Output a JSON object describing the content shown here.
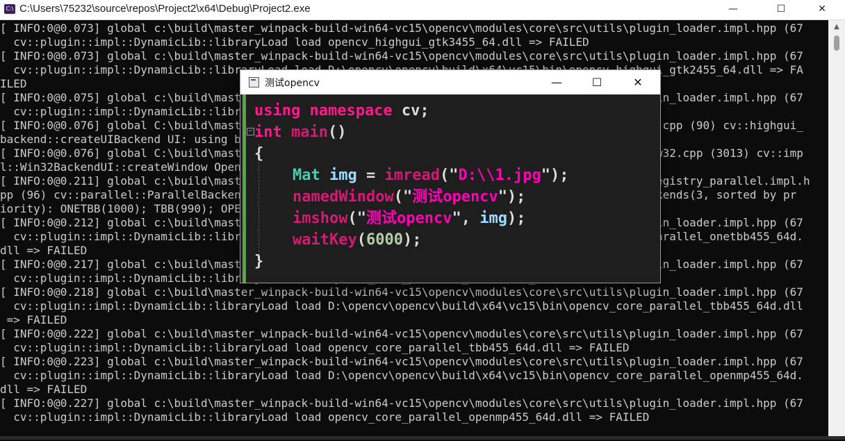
{
  "console_window": {
    "title": "C:\\Users\\75232\\source\\repos\\Project2\\x64\\Debug\\Project2.exe",
    "icon": "console-app-icon",
    "controls": {
      "minimize": "—",
      "maximize": "☐",
      "close": "✕"
    },
    "lines": [
      "[ INFO:0@0.073] global c:\\build\\master_winpack-build-win64-vc15\\opencv\\modules\\core\\src\\utils\\plugin_loader.impl.hpp (67",
      "  cv::plugin::impl::DynamicLib::libraryLoad load opencv_highgui_gtk3455_64.dll => FAILED",
      "[ INFO:0@0.073] global c:\\build\\master_winpack-build-win64-vc15\\opencv\\modules\\core\\src\\utils\\plugin_loader.impl.hpp (67",
      "  cv::plugin::impl::DynamicLib::libraryLoad load D:\\opencv\\opencv\\build\\x64\\vc15\\bin\\opencv_highgui_gtk2455_64.dll => FA",
      "ILED",
      "[ INFO:0@0.075] global c:\\build\\master_winpack-build-win64-vc15\\opencv\\modules\\core\\src\\utils\\plugin_loader.impl.hpp (67",
      "  cv::plugin::impl::DynamicLib::libraryLoad load opencv_highgui_gtk2455_64.dll => FAILED",
      "[ INFO:0@0.076] global C:\\build\\master_winpack-build-win64-vc15\\opencv\\modules\\highgui\\src\\backend.cpp (90) cv::highgui_",
      "backend::createUIBackend UI: using backend: WIN32 (priority=970)",
      "[ INFO:0@0.076] global C:\\build\\master_winpack-build-win64-vc15\\opencv\\modules\\highgui\\src\\window_w32.cpp (3013) cv::imp",
      "l::Win32BackendUI::createWindow OpenCV/UI: Creating Win32UI window: 测试opencv (1)",
      "[ INFO:0@0.211] global c:\\build\\master_winpack-build-win64-vc15\\opencv\\modules\\core\\src\\parallel\\registry_parallel.impl.h",
      "pp (96) cv::parallel::ParallelBackendRegistry::ParallelBackendRegistry core(parallel): Enabled backends(3, sorted by pr",
      "iority): ONETBB(1000); TBB(990); OPENMP(980)",
      "[ INFO:0@0.212] global c:\\build\\master_winpack-build-win64-vc15\\opencv\\modules\\core\\src\\utils\\plugin_loader.impl.hpp (67",
      "  cv::plugin::impl::DynamicLib::libraryLoad load D:\\opencv\\opencv\\build\\x64\\vc15\\bin\\opencv_core_parallel_onetbb455_64d.",
      "dll => FAILED",
      "[ INFO:0@0.217] global c:\\build\\master_winpack-build-win64-vc15\\opencv\\modules\\core\\src\\utils\\plugin_loader.impl.hpp (67",
      "  cv::plugin::impl::DynamicLib::libraryLoad load opencv_core_parallel_onetbb455_64d.dll => FAILED",
      "[ INFO:0@0.218] global c:\\build\\master_winpack-build-win64-vc15\\opencv\\modules\\core\\src\\utils\\plugin_loader.impl.hpp (67",
      "  cv::plugin::impl::DynamicLib::libraryLoad load D:\\opencv\\opencv\\build\\x64\\vc15\\bin\\opencv_core_parallel_tbb455_64d.dll",
      " => FAILED",
      "[ INFO:0@0.222] global c:\\build\\master_winpack-build-win64-vc15\\opencv\\modules\\core\\src\\utils\\plugin_loader.impl.hpp (67",
      "  cv::plugin::impl::DynamicLib::libraryLoad load opencv_core_parallel_tbb455_64d.dll => FAILED",
      "[ INFO:0@0.223] global c:\\build\\master_winpack-build-win64-vc15\\opencv\\modules\\core\\src\\utils\\plugin_loader.impl.hpp (67",
      "  cv::plugin::impl::DynamicLib::libraryLoad load D:\\opencv\\opencv\\build\\x64\\vc15\\bin\\opencv_core_parallel_openmp455_64d.",
      "dll => FAILED",
      "[ INFO:0@0.227] global c:\\build\\master_winpack-build-win64-vc15\\opencv\\modules\\core\\src\\utils\\plugin_loader.impl.hpp (67",
      "  cv::plugin::impl::DynamicLib::libraryLoad load opencv_core_parallel_openmp455_64d.dll => FAILED"
    ]
  },
  "opencv_window": {
    "title": "测试opencv",
    "controls": {
      "minimize": "—",
      "maximize": "☐",
      "close": "✕"
    },
    "code": {
      "line1": {
        "kw": "using namespace",
        "rest": " cv;"
      },
      "line2": {
        "type": "int",
        "fn": "main",
        "rest": "()"
      },
      "line3": "{",
      "line4": {
        "type": "Mat",
        "var": "img",
        "eq": " = ",
        "fn": "imread",
        "open": "(\"",
        "str": "D:\\\\1.jpg",
        "close": "\");"
      },
      "line5": {
        "fn": "namedWindow",
        "open": "(\"",
        "str": "测试opencv",
        "close": "\");"
      },
      "line6": {
        "fn": "imshow",
        "open": "(\"",
        "str": "测试opencv",
        "mid": "\", ",
        "var": "img",
        "close": ");"
      },
      "line7": {
        "fn": "waitKey",
        "open": "(",
        "num": "6000",
        "close": ");"
      },
      "line8": "}"
    }
  }
}
